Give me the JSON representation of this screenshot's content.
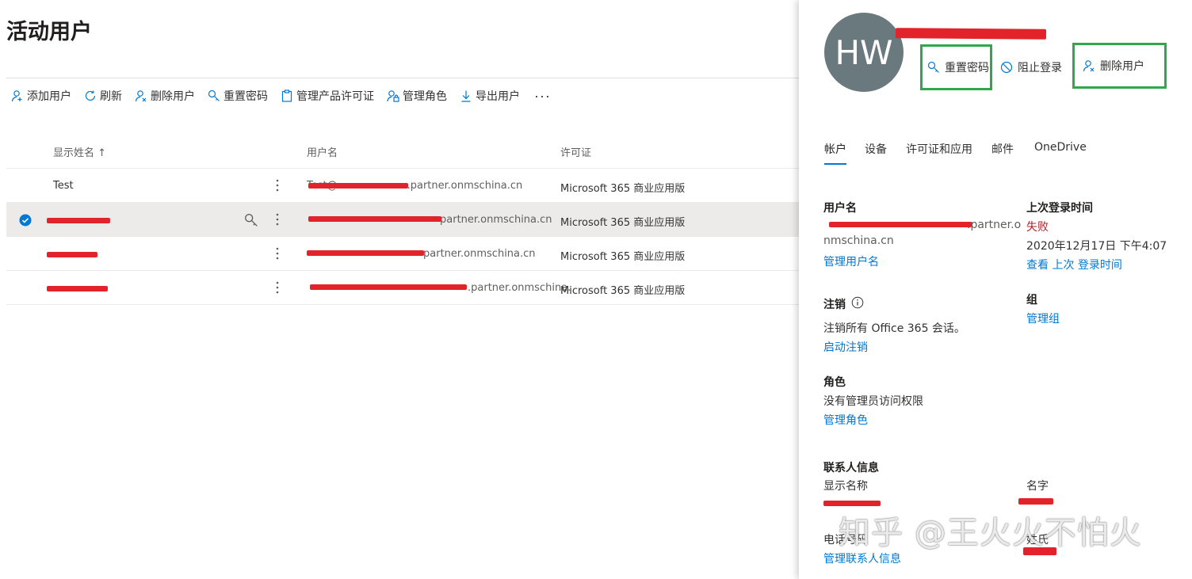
{
  "page": {
    "title": "活动用户"
  },
  "toolbar": {
    "add_user": "添加用户",
    "refresh": "刷新",
    "delete_user": "删除用户",
    "reset_password": "重置密码",
    "manage_license": "管理产品许可证",
    "manage_roles": "管理角色",
    "export_users": "导出用户",
    "more": "···"
  },
  "grid": {
    "columns": {
      "display_name": "显示姓名 ↑",
      "username": "用户名",
      "license": "许可证"
    },
    "rows": [
      {
        "display_name": "Test",
        "username": "Test@.partner.onmschina.cn",
        "username_suffix": ".partner.onmschina.cn",
        "license": "Microsoft 365 商业应用版",
        "selected": false
      },
      {
        "display_name": "",
        "username_suffix": "partner.onmschina.cn",
        "license": "Microsoft 365 商业应用版",
        "selected": true
      },
      {
        "display_name": "",
        "username_suffix": "partner.onmschina.cn",
        "license": "Microsoft 365 商业应用版",
        "selected": false
      },
      {
        "display_name": "",
        "username_suffix": ".partner.onmschina.",
        "license": "Microsoft 365 商业应用版",
        "selected": false
      }
    ]
  },
  "panel": {
    "avatar_initials": "HW",
    "actions": {
      "reset_password": "重置密码",
      "block_signin": "阻止登录",
      "delete_user": "删除用户"
    },
    "tabs": [
      "帐户",
      "设备",
      "许可证和应用",
      "邮件",
      "OneDrive"
    ],
    "username": {
      "label": "用户名",
      "value_line1": ".partner.o",
      "value_line2": "nmschina.cn",
      "link": "管理用户名"
    },
    "last_signin": {
      "label": "上次登录时间",
      "status": "失败",
      "time": "2020年12月17日 下午4:07",
      "link": "查看 上次 登录时间"
    },
    "signout": {
      "label": "注销",
      "desc": "注销所有 Office 365 会话。",
      "link": "启动注销"
    },
    "groups": {
      "label": "组",
      "link": "管理组"
    },
    "roles": {
      "label": "角色",
      "desc": "没有管理员访问权限",
      "link": "管理角色"
    },
    "contact": {
      "label": "联系人信息",
      "display_name_label": "显示名称",
      "first_name_label": "名字",
      "phone_label": "电话号码",
      "last_name_label": "姓氏",
      "link": "管理联系人信息"
    }
  },
  "watermark": "知乎 @王火火不怕火",
  "colors": {
    "accent": "#0078d4",
    "highlight_box": "#2ea84a",
    "redaction": "#e3232a",
    "avatar": "#69797e",
    "fail": "#a4262c"
  }
}
